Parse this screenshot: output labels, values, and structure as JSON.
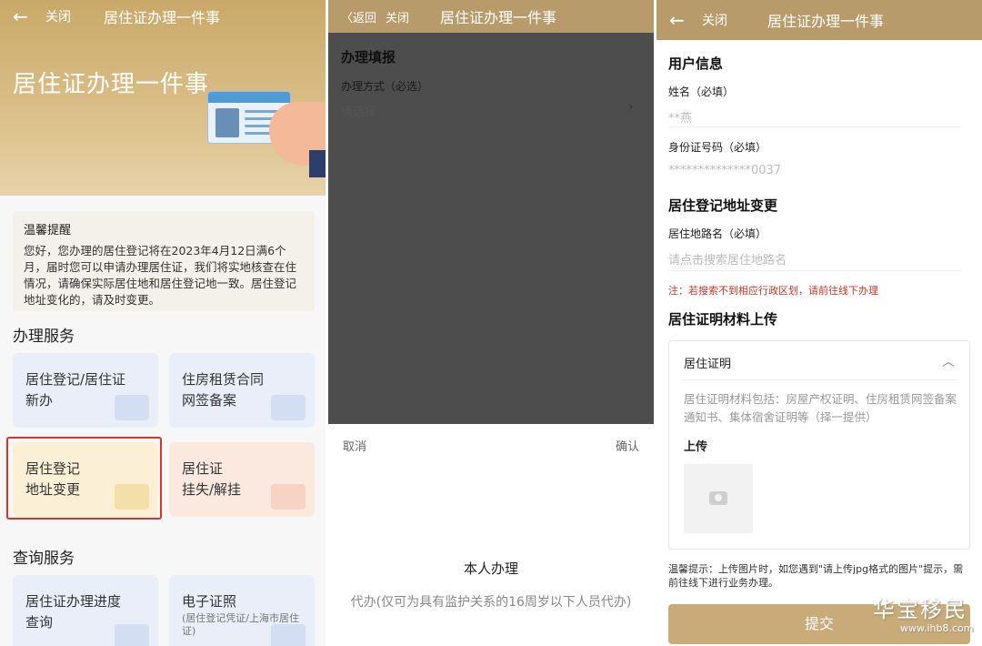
{
  "panel1": {
    "close": "关闭",
    "title": "居住证办理一件事",
    "hero_title": "居住证办理一件事",
    "notice_title": "温馨提醒",
    "notice_text": "您好，您办理的居住登记将在2023年4月12日满6个月，届时您可以申请办理居住证，我们将实地核查在住情况，请确保实际居住地和居住登记地一致。居住登记地址变化的，请及时变更。",
    "services_title": "办理服务",
    "services": [
      {
        "line1": "居住登记/居住证",
        "line2": "新办"
      },
      {
        "line1": "住房租赁合同",
        "line2": "网签备案"
      },
      {
        "line1": "居住登记",
        "line2": "地址变更"
      },
      {
        "line1": "居住证",
        "line2": "挂失/解挂"
      }
    ],
    "query_title": "查询服务",
    "queries": [
      {
        "line1": "居住证办理进度",
        "line2": "查询"
      },
      {
        "line1": "电子证照",
        "sub": "(居住登记凭证/上海市居住证)"
      }
    ]
  },
  "panel2": {
    "back": "〈返回",
    "close": "关闭",
    "title": "居住证办理一件事",
    "form_title": "办理填报",
    "method_label": "办理方式（必选）",
    "method_value": "请选择",
    "cancel": "取消",
    "confirm": "确认",
    "option1": "本人办理",
    "option2": "代办(仅可为具有监护关系的16周岁以下人员代办)"
  },
  "panel3": {
    "close": "关闭",
    "title": "居住证办理一件事",
    "user_info": "用户信息",
    "name_label": "姓名（必填）",
    "name_value": "**燕",
    "id_label": "身份证号码（必填）",
    "id_value": "**************0037",
    "addr_section": "居住登记地址变更",
    "road_label": "居住地路名（必填）",
    "road_placeholder": "请点击搜索居住地路名",
    "warn": "注：若搜索不到相应行政区划，请前往线下办理",
    "upload_section": "居住证明材料上传",
    "box_title": "居住证明",
    "box_desc": "居住证明材料包括：房屋产权证明、住房租赁网签备案通知书、集体宿舍证明等（择一提供）",
    "upload_label": "上传",
    "tip": "温馨提示：上传图片时，如您遇到\"请上传jpg格式的图片\"提示，需前往线下进行业务办理。",
    "submit": "提交"
  },
  "watermark": {
    "text": "华宝移民",
    "url": "www.ihb8.com"
  },
  "colors": {
    "gold": "#c8ab79",
    "highlight": "#d9362b",
    "warn": "#c0392b"
  }
}
